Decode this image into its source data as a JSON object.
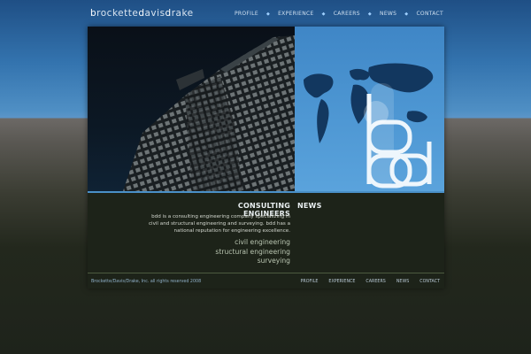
{
  "logo": {
    "part1_initial": "b",
    "part1_rest": "rockette",
    "part2_initial": "d",
    "part2_rest": "avis",
    "part3_initial": "d",
    "part3_rest": "rake"
  },
  "nav": [
    "PROFILE",
    "EXPERIENCE",
    "CAREERS",
    "NEWS",
    "CONTACT"
  ],
  "hero": {
    "monogram": "bdd",
    "accent_color": "#4a90c8"
  },
  "intro": {
    "title": "CONSULTING ENGINEERS",
    "body_line1": "bdd is a consulting engineering company specializing in",
    "body_line2": "civil and structural engineering and surveying.  bdd has a",
    "body_line3": "national reputation for engineering excellence."
  },
  "services": [
    "civil engineering",
    "structural engineering",
    "surveying"
  ],
  "news": {
    "title": "NEWS"
  },
  "footer": {
    "copyright": "Brockette/Davis/Drake, Inc. all rights reserved 2008",
    "nav": [
      "PROFILE",
      "EXPERIENCE",
      "CAREERS",
      "NEWS",
      "CONTACT"
    ]
  }
}
